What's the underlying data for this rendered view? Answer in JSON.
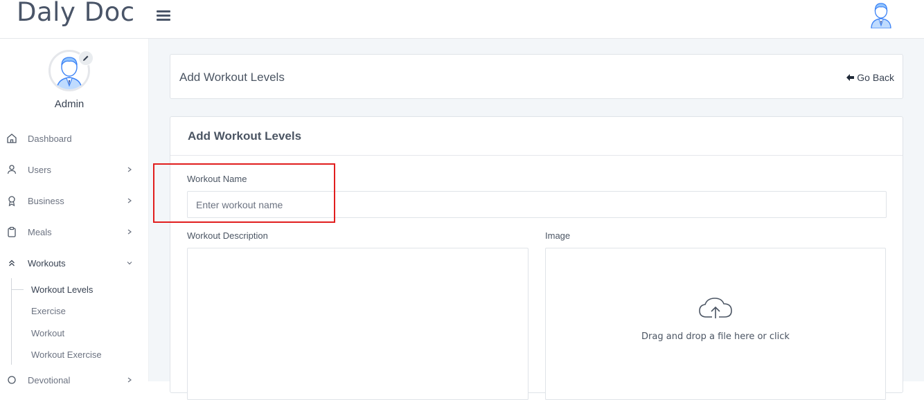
{
  "header": {
    "brand": "Daly Doc",
    "menu_icon": "hamburger-menu-icon",
    "user_icon": "user-avatar-icon"
  },
  "sidebar": {
    "profile_name": "Admin",
    "edit_icon": "pencil-icon",
    "items": [
      {
        "label": "Dashboard",
        "icon": "home-icon",
        "has_chevron": false
      },
      {
        "label": "Users",
        "icon": "user-icon",
        "has_chevron": true
      },
      {
        "label": "Business",
        "icon": "award-icon",
        "has_chevron": true
      },
      {
        "label": "Meals",
        "icon": "clipboard-icon",
        "has_chevron": true
      },
      {
        "label": "Workouts",
        "icon": "chevrons-up-icon",
        "has_chevron": true,
        "expanded": true
      },
      {
        "label": "Devotional",
        "icon": "circle-icon",
        "has_chevron": true
      }
    ],
    "subitems": [
      {
        "label": "Workout Levels",
        "active": true
      },
      {
        "label": "Exercise"
      },
      {
        "label": "Workout"
      },
      {
        "label": "Workout Exercise"
      }
    ]
  },
  "page": {
    "header_title": "Add Workout Levels",
    "go_back": "Go Back"
  },
  "form": {
    "title": "Add Workout Levels",
    "name_label": "Workout Name",
    "name_placeholder": "Enter workout name",
    "description_label": "Workout Description",
    "image_label": "Image",
    "dropzone_text": "Drag and drop a file here or click",
    "upload_icon": "cloud-upload-icon"
  },
  "colors": {
    "accent_highlight": "#e11d1d",
    "background": "#f3f6f9"
  }
}
